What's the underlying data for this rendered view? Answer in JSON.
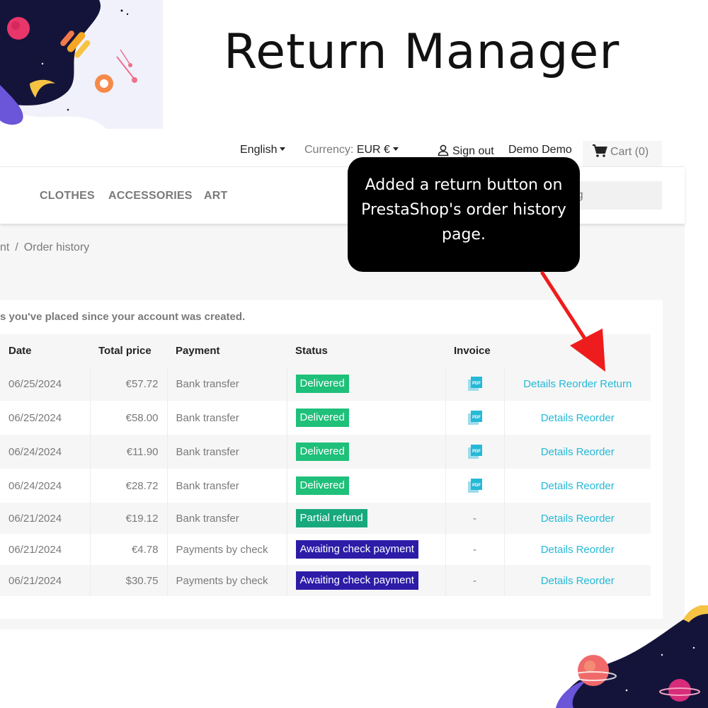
{
  "promo": {
    "title": "Return Manager"
  },
  "topbar": {
    "language": "English",
    "currency_label": "Currency:",
    "currency_value": "EUR €",
    "signout": "Sign out",
    "user": "Demo Demo",
    "cart": "Cart (0)"
  },
  "nav": {
    "items": [
      "CLOTHES",
      "ACCESSORIES",
      "ART"
    ]
  },
  "search": {
    "placeholder": "atalog"
  },
  "breadcrumb": {
    "items": [
      "nt",
      "Order history"
    ]
  },
  "intro": "s you've placed since your account was created.",
  "table": {
    "headers": [
      "Date",
      "Total price",
      "Payment",
      "Status",
      "Invoice",
      ""
    ],
    "rows": [
      {
        "date": "06/25/2024",
        "price": "€57.72",
        "payment": "Bank transfer",
        "status": "Delivered",
        "invoice": "pdf",
        "actions": [
          "Details",
          "Reorder",
          "Return"
        ]
      },
      {
        "date": "06/25/2024",
        "price": "€58.00",
        "payment": "Bank transfer",
        "status": "Delivered",
        "invoice": "pdf",
        "actions": [
          "Details",
          "Reorder"
        ]
      },
      {
        "date": "06/24/2024",
        "price": "€11.90",
        "payment": "Bank transfer",
        "status": "Delivered",
        "invoice": "pdf",
        "actions": [
          "Details",
          "Reorder"
        ]
      },
      {
        "date": "06/24/2024",
        "price": "€28.72",
        "payment": "Bank transfer",
        "status": "Delivered",
        "invoice": "pdf",
        "actions": [
          "Details",
          "Reorder"
        ]
      },
      {
        "date": "06/21/2024",
        "price": "€19.12",
        "payment": "Bank transfer",
        "status": "Partial refund",
        "invoice": "-",
        "actions": [
          "Details",
          "Reorder"
        ]
      },
      {
        "date": "06/21/2024",
        "price": "€4.78",
        "payment": "Payments by check",
        "status": "Awaiting check payment",
        "invoice": "-",
        "actions": [
          "Details",
          "Reorder"
        ]
      },
      {
        "date": "06/21/2024",
        "price": "$30.75",
        "payment": "Payments by check",
        "status": "Awaiting check payment",
        "invoice": "-",
        "actions": [
          "Details",
          "Reorder"
        ]
      }
    ]
  },
  "callout": {
    "lines": [
      "Added a return button on",
      "PrestaShop's order history",
      "page."
    ]
  },
  "colors": {
    "delivered": "#1ec07a",
    "partial_refund": "#17a97c",
    "awaiting_check": "#2d1ca8",
    "link": "#24b9d7",
    "arrow": "#ee1c1c"
  },
  "icons": {
    "user": "user-icon",
    "cart": "cart-icon",
    "invoice": "pdf-icon"
  }
}
